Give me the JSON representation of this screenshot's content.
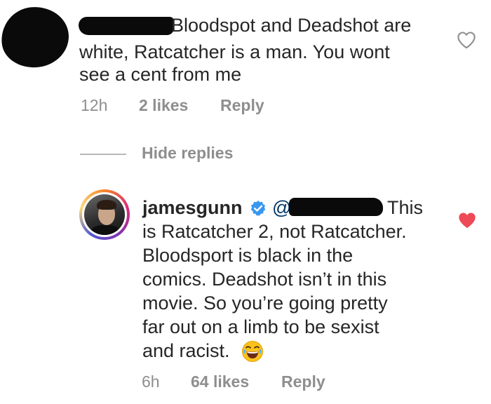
{
  "comment": {
    "text_line1": "Bloodspot and Deadshot are",
    "text_line2": "white, Ratcatcher is a man. You wont",
    "text_line3": "see a cent from me",
    "time": "12h",
    "likes": "2 likes",
    "reply_label": "Reply",
    "liked": false
  },
  "hide_replies_label": "Hide replies",
  "reply": {
    "username": "jamesgunn",
    "verified": true,
    "mention_prefix": "@",
    "text_line1": "This",
    "text_line2": "is Ratcatcher 2, not Ratcatcher.",
    "text_line3": "Bloodsport is black in the",
    "text_line4": "comics. Deadshot isn’t in this",
    "text_line5": "movie. So you’re going pretty",
    "text_line6": "far out on a limb to be sexist",
    "text_line7": "and racist.",
    "emoji": "face-with-tears-of-joy",
    "time": "6h",
    "likes": "64 likes",
    "reply_label": "Reply",
    "liked": true
  },
  "colors": {
    "text": "#262626",
    "meta": "#8e8e8e",
    "heart_liked": "#ed4956",
    "heart_outline": "#8e8e8e",
    "verified": "#3897f0",
    "mention": "#003569"
  }
}
